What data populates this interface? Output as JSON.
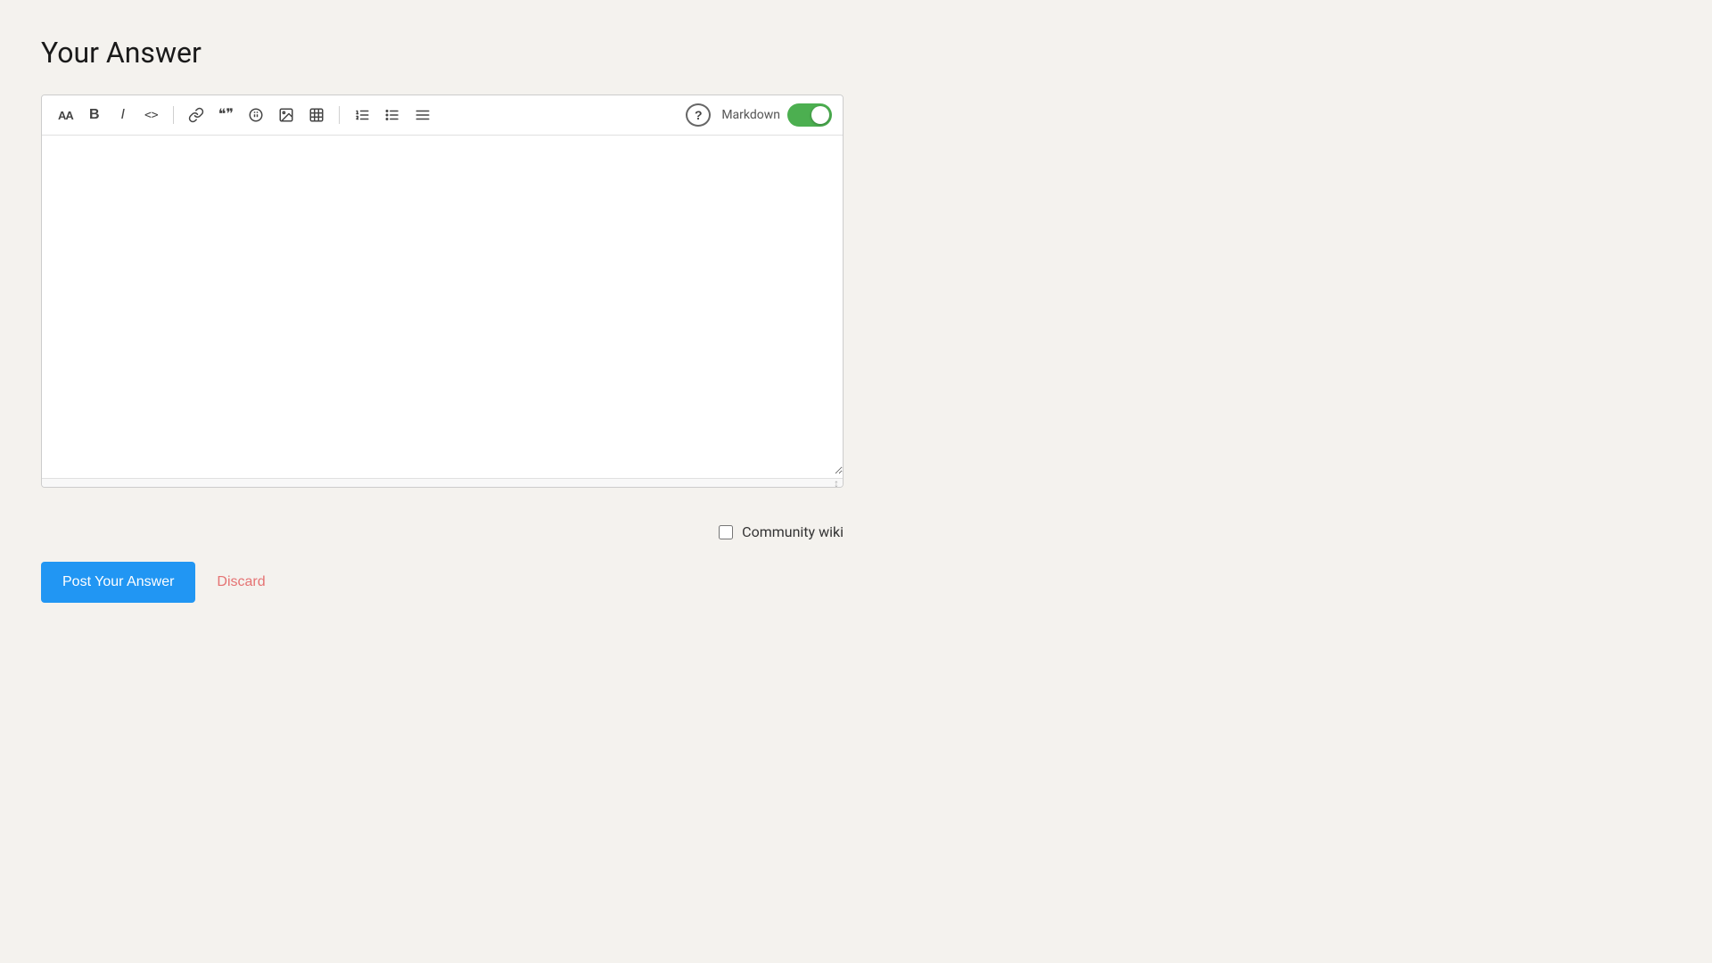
{
  "page": {
    "title": "Your Answer",
    "background_color": "#f4f2ee"
  },
  "toolbar": {
    "buttons": [
      {
        "name": "heading-icon",
        "label": "AA",
        "title": "Heading",
        "icon_type": "text"
      },
      {
        "name": "bold-icon",
        "label": "B",
        "title": "Bold",
        "icon_type": "bold"
      },
      {
        "name": "italic-icon",
        "label": "I",
        "title": "Italic",
        "icon_type": "italic"
      },
      {
        "name": "code-icon",
        "label": "<>",
        "title": "Code",
        "icon_type": "code"
      }
    ],
    "buttons2": [
      {
        "name": "link-icon",
        "label": "🔗",
        "title": "Link",
        "icon_type": "unicode"
      },
      {
        "name": "blockquote-icon",
        "label": "❝❞",
        "title": "Blockquote",
        "icon_type": "unicode"
      },
      {
        "name": "snippet-icon",
        "label": "◈",
        "title": "Code Snippet",
        "icon_type": "unicode"
      },
      {
        "name": "image-icon",
        "label": "🖼",
        "title": "Image",
        "icon_type": "unicode"
      },
      {
        "name": "table-icon",
        "label": "⊞",
        "title": "Table",
        "icon_type": "unicode"
      }
    ],
    "buttons3": [
      {
        "name": "ordered-list-icon",
        "label": "≡1",
        "title": "Ordered List",
        "icon_type": "unicode"
      },
      {
        "name": "unordered-list-icon",
        "label": "≡•",
        "title": "Unordered List",
        "icon_type": "unicode"
      },
      {
        "name": "indent-icon",
        "label": "☰",
        "title": "Indent",
        "icon_type": "unicode"
      }
    ],
    "help_label": "?",
    "markdown_label": "Markdown",
    "markdown_enabled": true,
    "toggle_color": "#4caf50"
  },
  "editor": {
    "placeholder": ""
  },
  "community_wiki": {
    "label": "Community wiki",
    "checked": false
  },
  "actions": {
    "post_button_label": "Post Your Answer",
    "discard_button_label": "Discard"
  }
}
